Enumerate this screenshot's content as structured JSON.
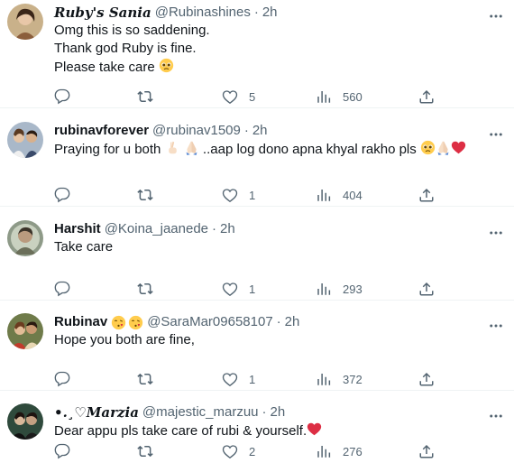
{
  "tweets": [
    {
      "name": "𝑹𝒖𝒃𝒚'𝒔 𝑺𝒂𝒏𝒊𝒂",
      "handle": "@Rubinashines",
      "dot": "·",
      "time": "2h",
      "lines": [
        "Omg this is so saddening.",
        "Thank god Ruby is fine.",
        "Please take care"
      ],
      "likes": "5",
      "views": "560",
      "avatar": "avatar-woman-1"
    },
    {
      "name": "rubinavforever",
      "handle": "@rubinav1509",
      "dot": "·",
      "time": "2h",
      "lines": [
        "Praying for u both",
        "..aap log dono apna khyal rakho pls"
      ],
      "likes": "1",
      "views": "404",
      "avatar": "avatar-couple"
    },
    {
      "name": "Harshit",
      "handle": "@Koina_jaanede",
      "dot": "·",
      "time": "2h",
      "lines": [
        "Take care"
      ],
      "likes": "1",
      "views": "293",
      "avatar": "avatar-man"
    },
    {
      "name": "Rubinav",
      "handle": "@SaraMar09658107",
      "dot": "·",
      "time": "2h",
      "lines": [
        "Hope you both are fine,"
      ],
      "likes": "1",
      "views": "372",
      "avatar": "avatar-couple-2"
    },
    {
      "name": "•.¸♡𝑴𝒂𝒓𝒛𝒊𝒂",
      "handle": "@majestic_marzuu",
      "dot": "·",
      "time": "2h",
      "lines": [
        "Dear appu pls take care of rubi & yourself."
      ],
      "likes": "2",
      "views": "276",
      "avatar": "avatar-couple-3"
    }
  ],
  "colors": {
    "text": "#0f1419",
    "secondary": "#536471",
    "divider": "#eff3f4",
    "heart": "#e0245e"
  }
}
